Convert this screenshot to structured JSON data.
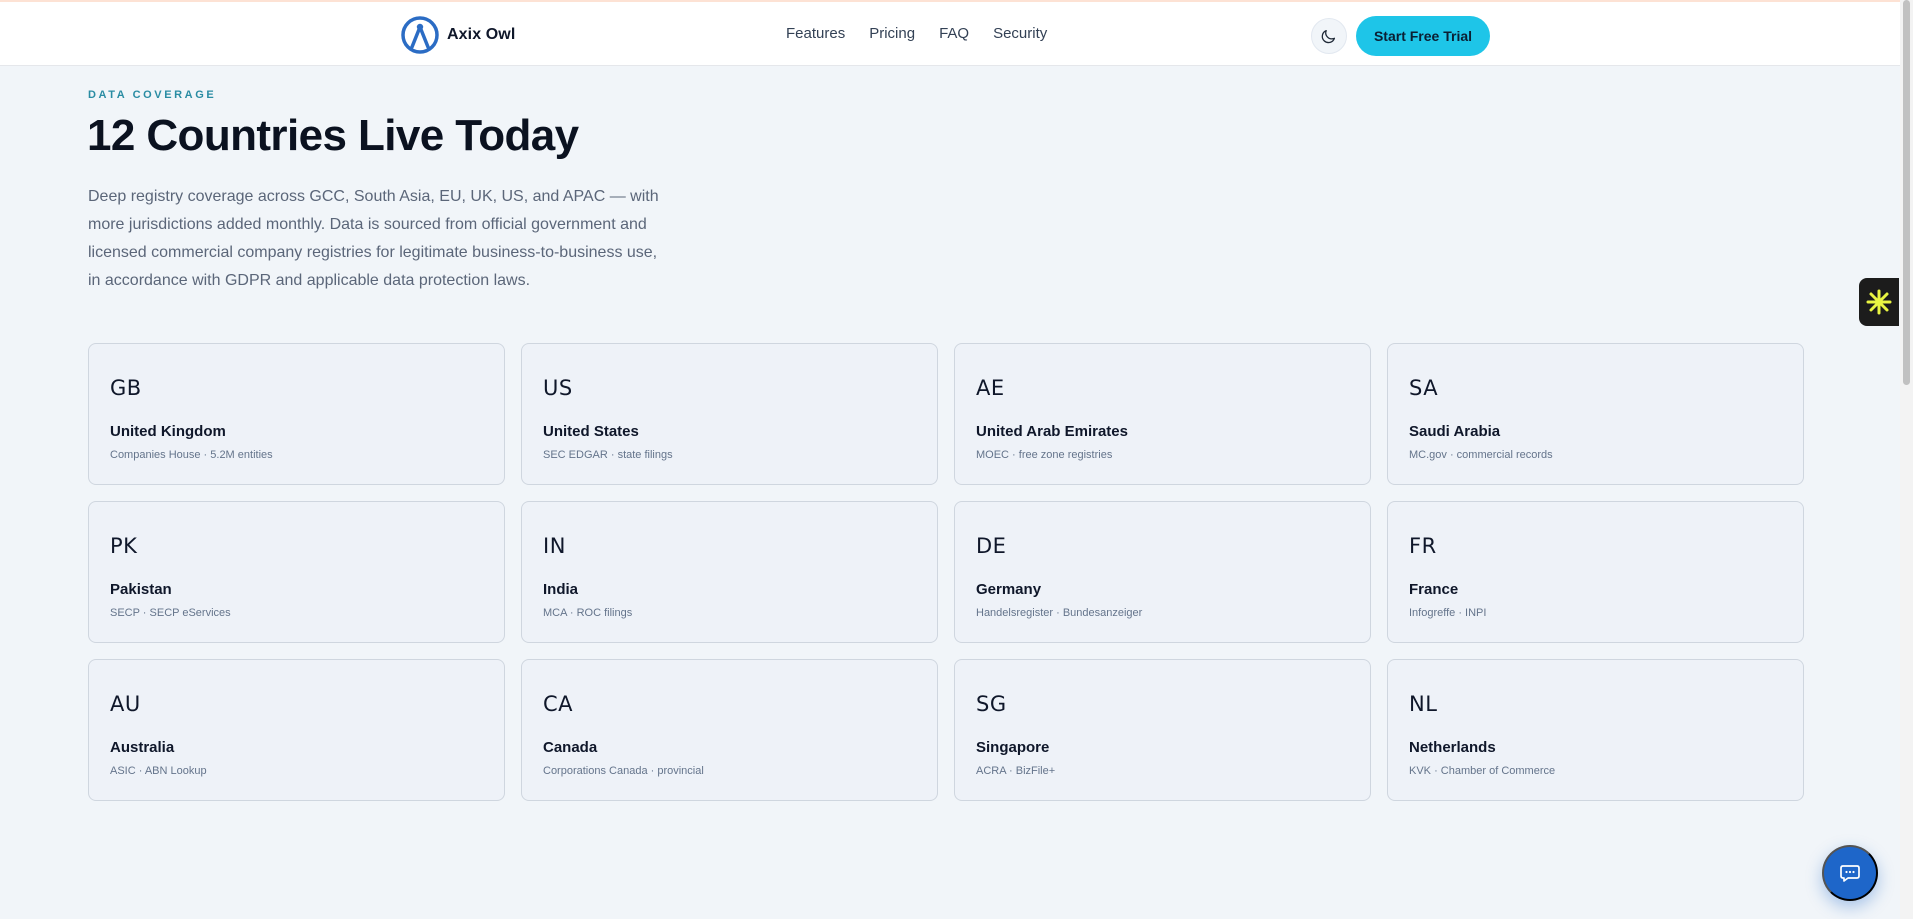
{
  "nav": {
    "brand": "Axix Owl",
    "links": [
      "Features",
      "Pricing",
      "FAQ",
      "Security"
    ],
    "cta": "Start Free Trial"
  },
  "hero": {
    "eyebrow": "DATA COVERAGE",
    "title": "12 Countries Live Today",
    "description": "Deep registry coverage across GCC, South Asia, EU, UK, US, and APAC — with more jurisdictions added monthly. Data is sourced from official government and licensed commercial company registries for legitimate business-to-business use, in accordance with GDPR and applicable data protection laws."
  },
  "countries": [
    {
      "code": "GB",
      "name": "United Kingdom",
      "source": "Companies House · 5.2M entities"
    },
    {
      "code": "US",
      "name": "United States",
      "source": "SEC EDGAR · state filings"
    },
    {
      "code": "AE",
      "name": "United Arab Emirates",
      "source": "MOEC · free zone registries"
    },
    {
      "code": "SA",
      "name": "Saudi Arabia",
      "source": "MC.gov · commercial records"
    },
    {
      "code": "PK",
      "name": "Pakistan",
      "source": "SECP · SECP eServices"
    },
    {
      "code": "IN",
      "name": "India",
      "source": "MCA · ROC filings"
    },
    {
      "code": "DE",
      "name": "Germany",
      "source": "Handelsregister · Bundesanzeiger"
    },
    {
      "code": "FR",
      "name": "France",
      "source": "Infogreffe · INPI"
    },
    {
      "code": "AU",
      "name": "Australia",
      "source": "ASIC · ABN Lookup"
    },
    {
      "code": "CA",
      "name": "Canada",
      "source": "Corporations Canada · provincial"
    },
    {
      "code": "SG",
      "name": "Singapore",
      "source": "ACRA · BizFile+"
    },
    {
      "code": "NL",
      "name": "Netherlands",
      "source": "KVK · Chamber of Commerce"
    }
  ],
  "icons": {
    "logo": "owl-logo-icon",
    "theme": "moon-icon",
    "widget": "asterisk-icon",
    "chat": "chat-bubble-icon"
  },
  "colors": {
    "accent": "#1ec5e8",
    "brand_blue": "#2b6cc4",
    "eyebrow": "#2a8ca3",
    "chat_button": "#1e66c9"
  }
}
